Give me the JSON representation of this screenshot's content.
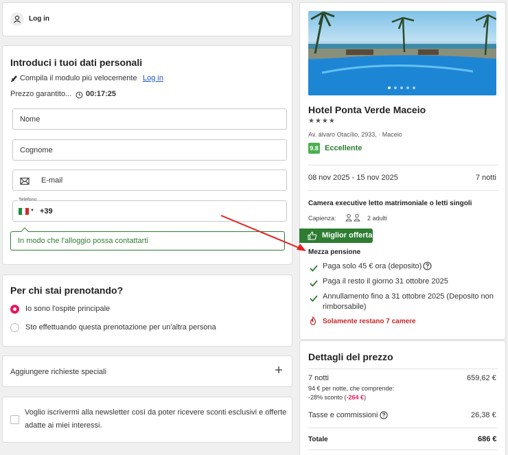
{
  "login_card": {
    "label": "Log in"
  },
  "personal": {
    "title": "Introduci i tuoi dati personali",
    "quick_text": "Compila il modulo più velocemente",
    "quick_link": "Log in",
    "price_guarantee": "Prezzo garantito...",
    "timer": "00:17:25",
    "name_placeholder": "Nome",
    "surname_placeholder": "Cognome",
    "email_placeholder": "E-mail",
    "phone_label": "Telefono",
    "phone_prefix": "+39",
    "phone_hint": "In modo che l'alloggio possa contattarti"
  },
  "booking_for": {
    "title": "Per chi stai prenotando?",
    "options": [
      "Io sono l'ospite principale",
      "Sto effettuando questa prenotazione per un'altra persona"
    ]
  },
  "special_requests": {
    "label": "Aggiungere richieste speciali"
  },
  "newsletter": {
    "text_line1": "Voglio iscrivermi alla newsletter così da poter ricevere sconti esclusivi e offerte",
    "text_line2": "adatte ai miei interessi."
  },
  "hotel": {
    "name": "Hotel Ponta Verde Maceio",
    "stars": "★★★★",
    "address": "Av. álvaro Otacílio, 2933, · Maceio",
    "rating_score": "9.8",
    "rating_label": "Eccellente",
    "dates": "08 nov 2025 - 15 nov 2025",
    "nights": "7 notti",
    "room": "Camera executive letto matrimoniale o letti singoli",
    "capacity_label": "Capienza:",
    "capacity_value": "2 adulti",
    "best_offer": "Miglior offerta",
    "board": "Mezza pensione",
    "conditions": [
      "Paga solo 45 € ora (deposito)",
      "Paga il resto il giorno 31 ottobre 2025",
      "Annullamento fino a 31 ottobre 2025 (Deposito non",
      "rimborsabile)"
    ],
    "scarcity": "Solamente restano 7 camere"
  },
  "price": {
    "title": "Dettagli del prezzo",
    "nights_label": "7 notti",
    "nights_value": "659,62 €",
    "per_night": "94 € per notte, che comprende:",
    "discount_prefix": "-28% sconto (",
    "discount_value": "-264 €",
    "discount_suffix": ")",
    "taxes_label": "Tasse e commissioni",
    "taxes_value": "26,38 €",
    "total_label": "Totale",
    "total_value": "686 €"
  },
  "colors": {
    "accent_green": "#2e7d32",
    "primary_pink": "#e8175d",
    "alert_red": "#c62828",
    "rating_green": "#4caf50"
  }
}
